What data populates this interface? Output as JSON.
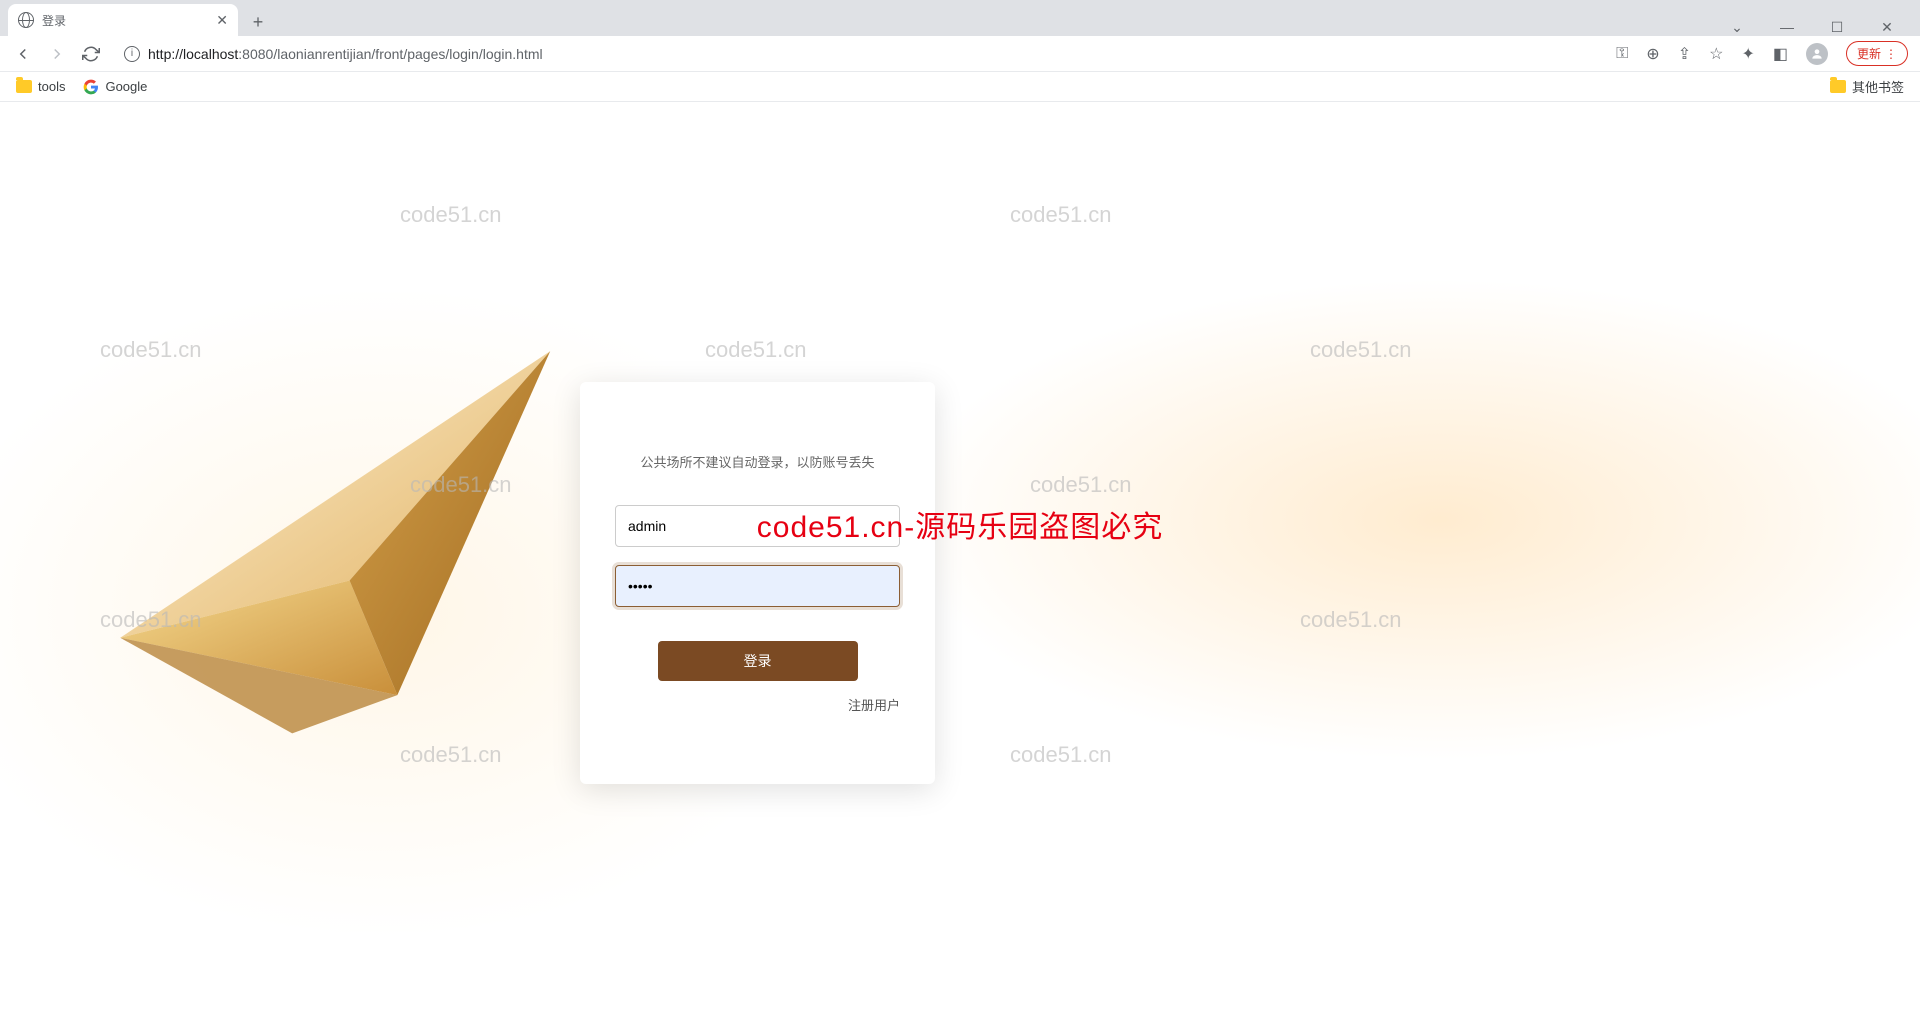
{
  "browser": {
    "tab_title": "登录",
    "url_host": "localhost",
    "url_port": ":8080",
    "url_path": "/laonianrentijian/front/pages/login/login.html",
    "update_label": "更新",
    "bookmarks": {
      "tools": "tools",
      "google": "Google",
      "other": "其他书签"
    }
  },
  "watermark_text": "code51.cn",
  "overlay": "code51.cn-源码乐园盗图必究",
  "login": {
    "hint": "公共场所不建议自动登录，以防账号丢失",
    "username_value": "admin",
    "password_value": "•••••",
    "button_label": "登录",
    "register_label": "注册用户"
  }
}
